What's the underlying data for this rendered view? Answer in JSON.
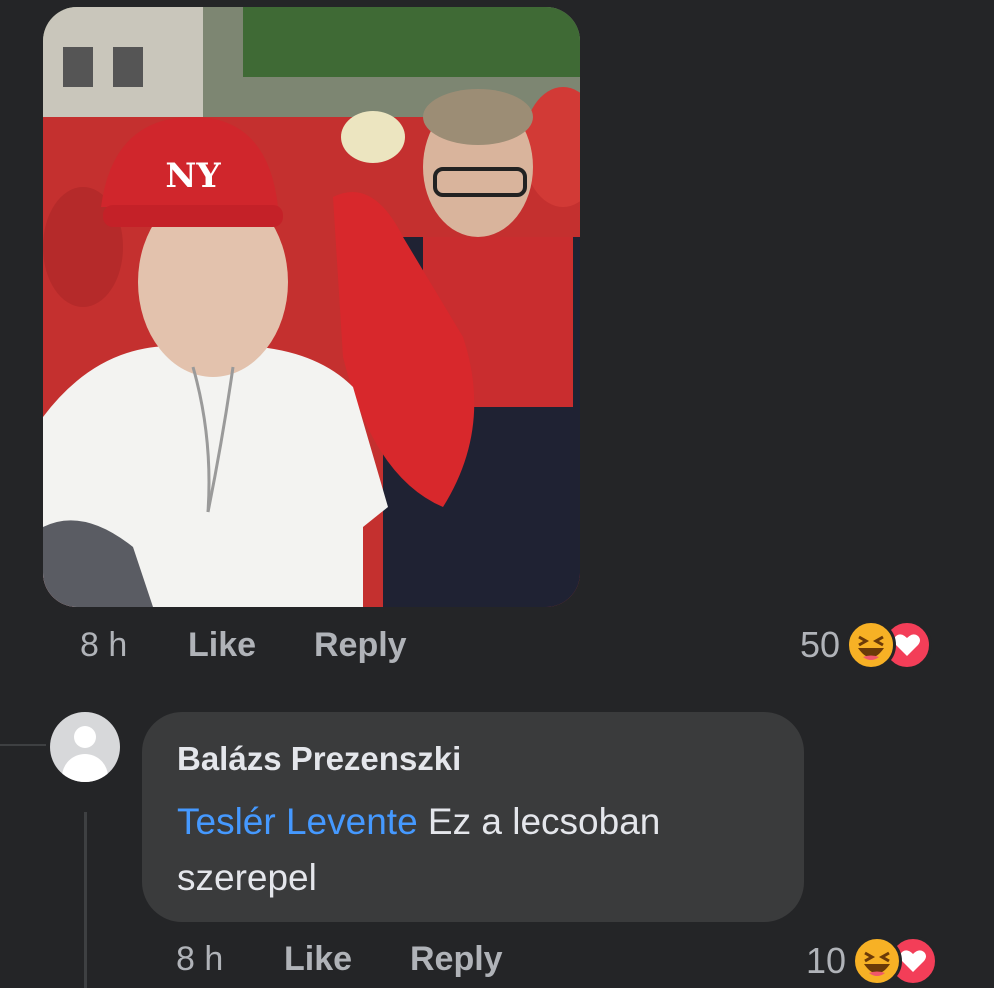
{
  "post": {
    "image_alt": "Photo of young people in red clothes at an outdoor gathering",
    "time": "8 h",
    "like_label": "Like",
    "reply_label": "Reply",
    "reaction_count": "50",
    "reactions": [
      "haha-icon",
      "love-icon"
    ]
  },
  "reply_comment": {
    "author": "Balázs Prezenszki",
    "mention": "Teslér Levente",
    "text": " Ez a lecsoban szerepel",
    "time": "8 h",
    "like_label": "Like",
    "reply_label": "Reply",
    "reaction_count": "10",
    "reactions": [
      "haha-icon",
      "love-icon"
    ]
  },
  "colors": {
    "background": "#242527",
    "bubble": "#3a3b3c",
    "mention": "#4599ff",
    "meta_text": "#b0b3b8",
    "haha": "#f7b125",
    "love": "#f33e58"
  }
}
